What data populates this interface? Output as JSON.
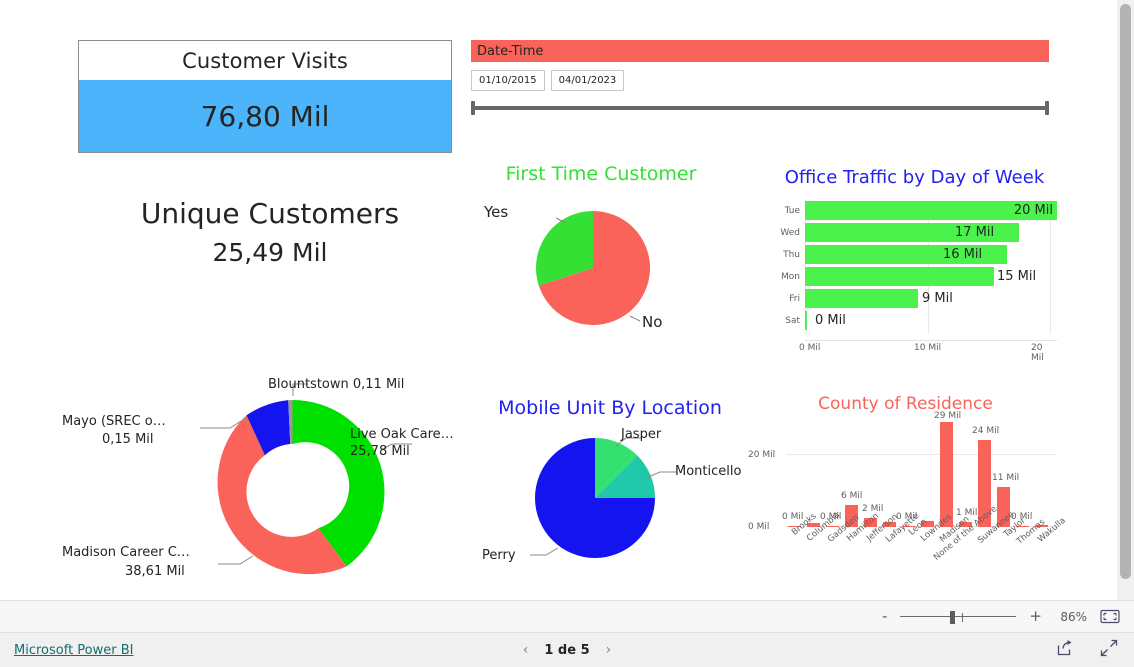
{
  "colors": {
    "blue_kpi": "#4cb4fa",
    "coral": "#fa6359",
    "green": "#33e033",
    "bright_green": "#4cf24c",
    "pure_blue": "#1414f0",
    "teal": "#1fc8a8",
    "title_blue": "#2222f0",
    "link_teal": "#126e70"
  },
  "kpi": {
    "title": "Customer Visits",
    "value": "76,80 Mil"
  },
  "unique_customers": {
    "title": "Unique Customers",
    "value": "25,49 Mil"
  },
  "slicer": {
    "title": "Date-Time",
    "start_date": "01/10/2015",
    "end_date": "04/01/2023"
  },
  "chart_data": [
    {
      "type": "pie",
      "title": "First Time Customer",
      "name": "first-time-customer",
      "categories": [
        "Yes",
        "No"
      ],
      "values": [
        20,
        80
      ],
      "colors": [
        "#33e033",
        "#fa6359"
      ],
      "labels": [
        "Yes",
        "No"
      ],
      "legend": "none"
    },
    {
      "type": "bar",
      "title": "Office Traffic by Day of Week",
      "name": "office-traffic-by-day-of-week",
      "orientation": "horizontal",
      "categories": [
        "Tue",
        "Wed",
        "Thu",
        "Mon",
        "Fri",
        "Sat"
      ],
      "values": [
        20,
        17,
        16,
        15,
        9,
        0
      ],
      "value_labels": [
        "20 Mil",
        "17 Mil",
        "16 Mil",
        "15 Mil",
        "9 Mil",
        "0 Mil"
      ],
      "label_position": [
        "inside",
        "inside",
        "inside",
        "outside",
        "outside",
        "outside"
      ],
      "xlabel": "",
      "ylabel": "",
      "xlim": [
        0,
        20
      ],
      "xticks": [
        "0 Mil",
        "10 Mil",
        "20 Mil"
      ],
      "grid": true,
      "color": "#4cf24c"
    },
    {
      "type": "pie",
      "title": "",
      "name": "customers-by-center-donut",
      "variant": "donut",
      "categories": [
        "Live Oak Care…",
        "Madison Career C…",
        "Mayo (SREC o…",
        "Blountstown"
      ],
      "values": [
        25.78,
        38.61,
        0.15,
        0.11
      ],
      "value_labels": [
        "25,78 Mil",
        "38,61 Mil",
        "0,15 Mil",
        "0,11 Mil"
      ],
      "colors": [
        "#00e000",
        "#fa6359",
        "#1414f0",
        "#9a9a9a"
      ],
      "labels": [
        "Blountstown 0,11 Mil",
        "Live Oak Care…",
        "25,78 Mil",
        "Mayo (SREC o…",
        "0,15 Mil",
        "Madison Career C…",
        "38,61 Mil"
      ]
    },
    {
      "type": "pie",
      "title": "Mobile Unit By Location",
      "name": "mobile-unit-by-location",
      "categories": [
        "Jasper",
        "Monticello",
        "Perry"
      ],
      "values": [
        12.5,
        12.5,
        75
      ],
      "colors": [
        "#33e070",
        "#1fc8a8",
        "#1414f0"
      ],
      "labels": [
        "Jasper",
        "Monticello",
        "Perry"
      ]
    },
    {
      "type": "bar",
      "title": "County of Residence",
      "name": "county-of-residence",
      "orientation": "vertical",
      "categories": [
        "Brooks",
        "Columbia",
        "Gadsden",
        "Hamilton",
        "Jefferson",
        "Lafayette",
        "Leon",
        "Lowndes",
        "Madison",
        "None of the Above",
        "Suwannee",
        "Taylor",
        "Thomas",
        "Wakulla"
      ],
      "values": [
        0,
        0.6,
        0,
        6,
        2,
        0.7,
        0,
        0.9,
        29,
        1,
        24,
        11,
        0,
        0
      ],
      "value_labels": [
        "0 Mil",
        "",
        "0 Mil",
        "6 Mil",
        "2 Mil",
        "",
        "0 Mil",
        "",
        "29 Mil",
        "1 Mil",
        "24 Mil",
        "11 Mil",
        "0 Mil",
        ""
      ],
      "ylabel": "",
      "xlabel": "",
      "ylim": [
        0,
        29
      ],
      "yticks": [
        "0 Mil",
        "20 Mil"
      ],
      "grid": true,
      "color": "#fa6359"
    }
  ],
  "statusbar": {
    "zoom_out_label": "-",
    "zoom_in_label": "+",
    "zoom_percent": "86%",
    "fit_icon": "fit-to-page-icon"
  },
  "footer": {
    "brand_link": "Microsoft Power BI",
    "prev_label": "‹",
    "next_label": "›",
    "page_text": "1 de 5",
    "share_icon": "share-icon",
    "fullscreen_icon": "fullscreen-icon"
  }
}
